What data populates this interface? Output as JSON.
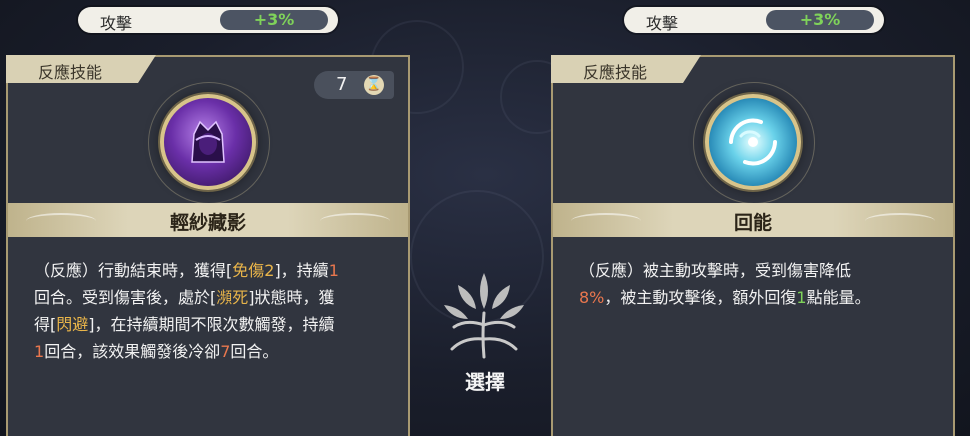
{
  "left_stat": {
    "label": "攻擊",
    "value": "+3%"
  },
  "right_stat": {
    "label": "攻擊",
    "value": "+3%"
  },
  "left_card": {
    "tab": "反應技能",
    "cooldown": "7",
    "icon": "hooded-figure-icon",
    "name": "輕紗藏影",
    "desc": [
      [
        {
          "t": "（反應）行動結束時，獲得["
        },
        {
          "t": "免傷2",
          "c": "y"
        },
        {
          "t": "]，持續"
        },
        {
          "t": "1",
          "c": "o"
        }
      ],
      [
        {
          "t": "回合。受到傷害後，處於["
        },
        {
          "t": "瀕死",
          "c": "y"
        },
        {
          "t": "]狀態時，獲"
        }
      ],
      [
        {
          "t": "得["
        },
        {
          "t": "閃避",
          "c": "y"
        },
        {
          "t": "]，在持續期間不限次數觸發，持續"
        }
      ],
      [
        {
          "t": "1",
          "c": "o"
        },
        {
          "t": "回合，該效果觸發後冷卻"
        },
        {
          "t": "7",
          "c": "o"
        },
        {
          "t": "回合。"
        }
      ]
    ]
  },
  "right_card": {
    "tab": "反應技能",
    "icon": "energy-swirl-icon",
    "name": "回能",
    "desc": [
      [
        {
          "t": "（反應）被主動攻擊時，受到傷害降低"
        }
      ],
      [
        {
          "t": "8%",
          "c": "o"
        },
        {
          "t": "，被主動攻擊後，額外回復"
        },
        {
          "t": "1",
          "c": "g"
        },
        {
          "t": "點能量。"
        }
      ]
    ]
  },
  "select": {
    "label": "選擇",
    "icon": "tree-emblem-icon"
  },
  "colors": {
    "accent_yellow": "#e9b54a",
    "accent_orange": "#e9774e",
    "accent_green": "#7fd25a",
    "gold_border": "#a89a72"
  }
}
